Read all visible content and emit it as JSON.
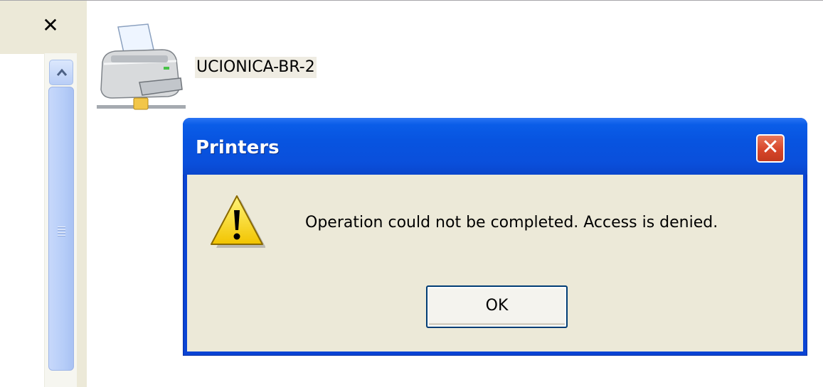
{
  "task_pane": {
    "close_glyph": "✕",
    "icons": {
      "close": "close-icon",
      "scroll_up": "chevron-up-icon"
    }
  },
  "printer": {
    "name": "UCIONICA-BR-2",
    "icon": "network-printer-icon"
  },
  "dialog": {
    "title": "Printers",
    "close_glyph": "✕",
    "icon": "warning-icon",
    "message": "Operation could not be completed. Access is denied.",
    "ok_label": "OK"
  },
  "colors": {
    "titlebar": "#0a54e0",
    "dialog_body": "#ece9d8",
    "close_button": "#d7462a"
  }
}
